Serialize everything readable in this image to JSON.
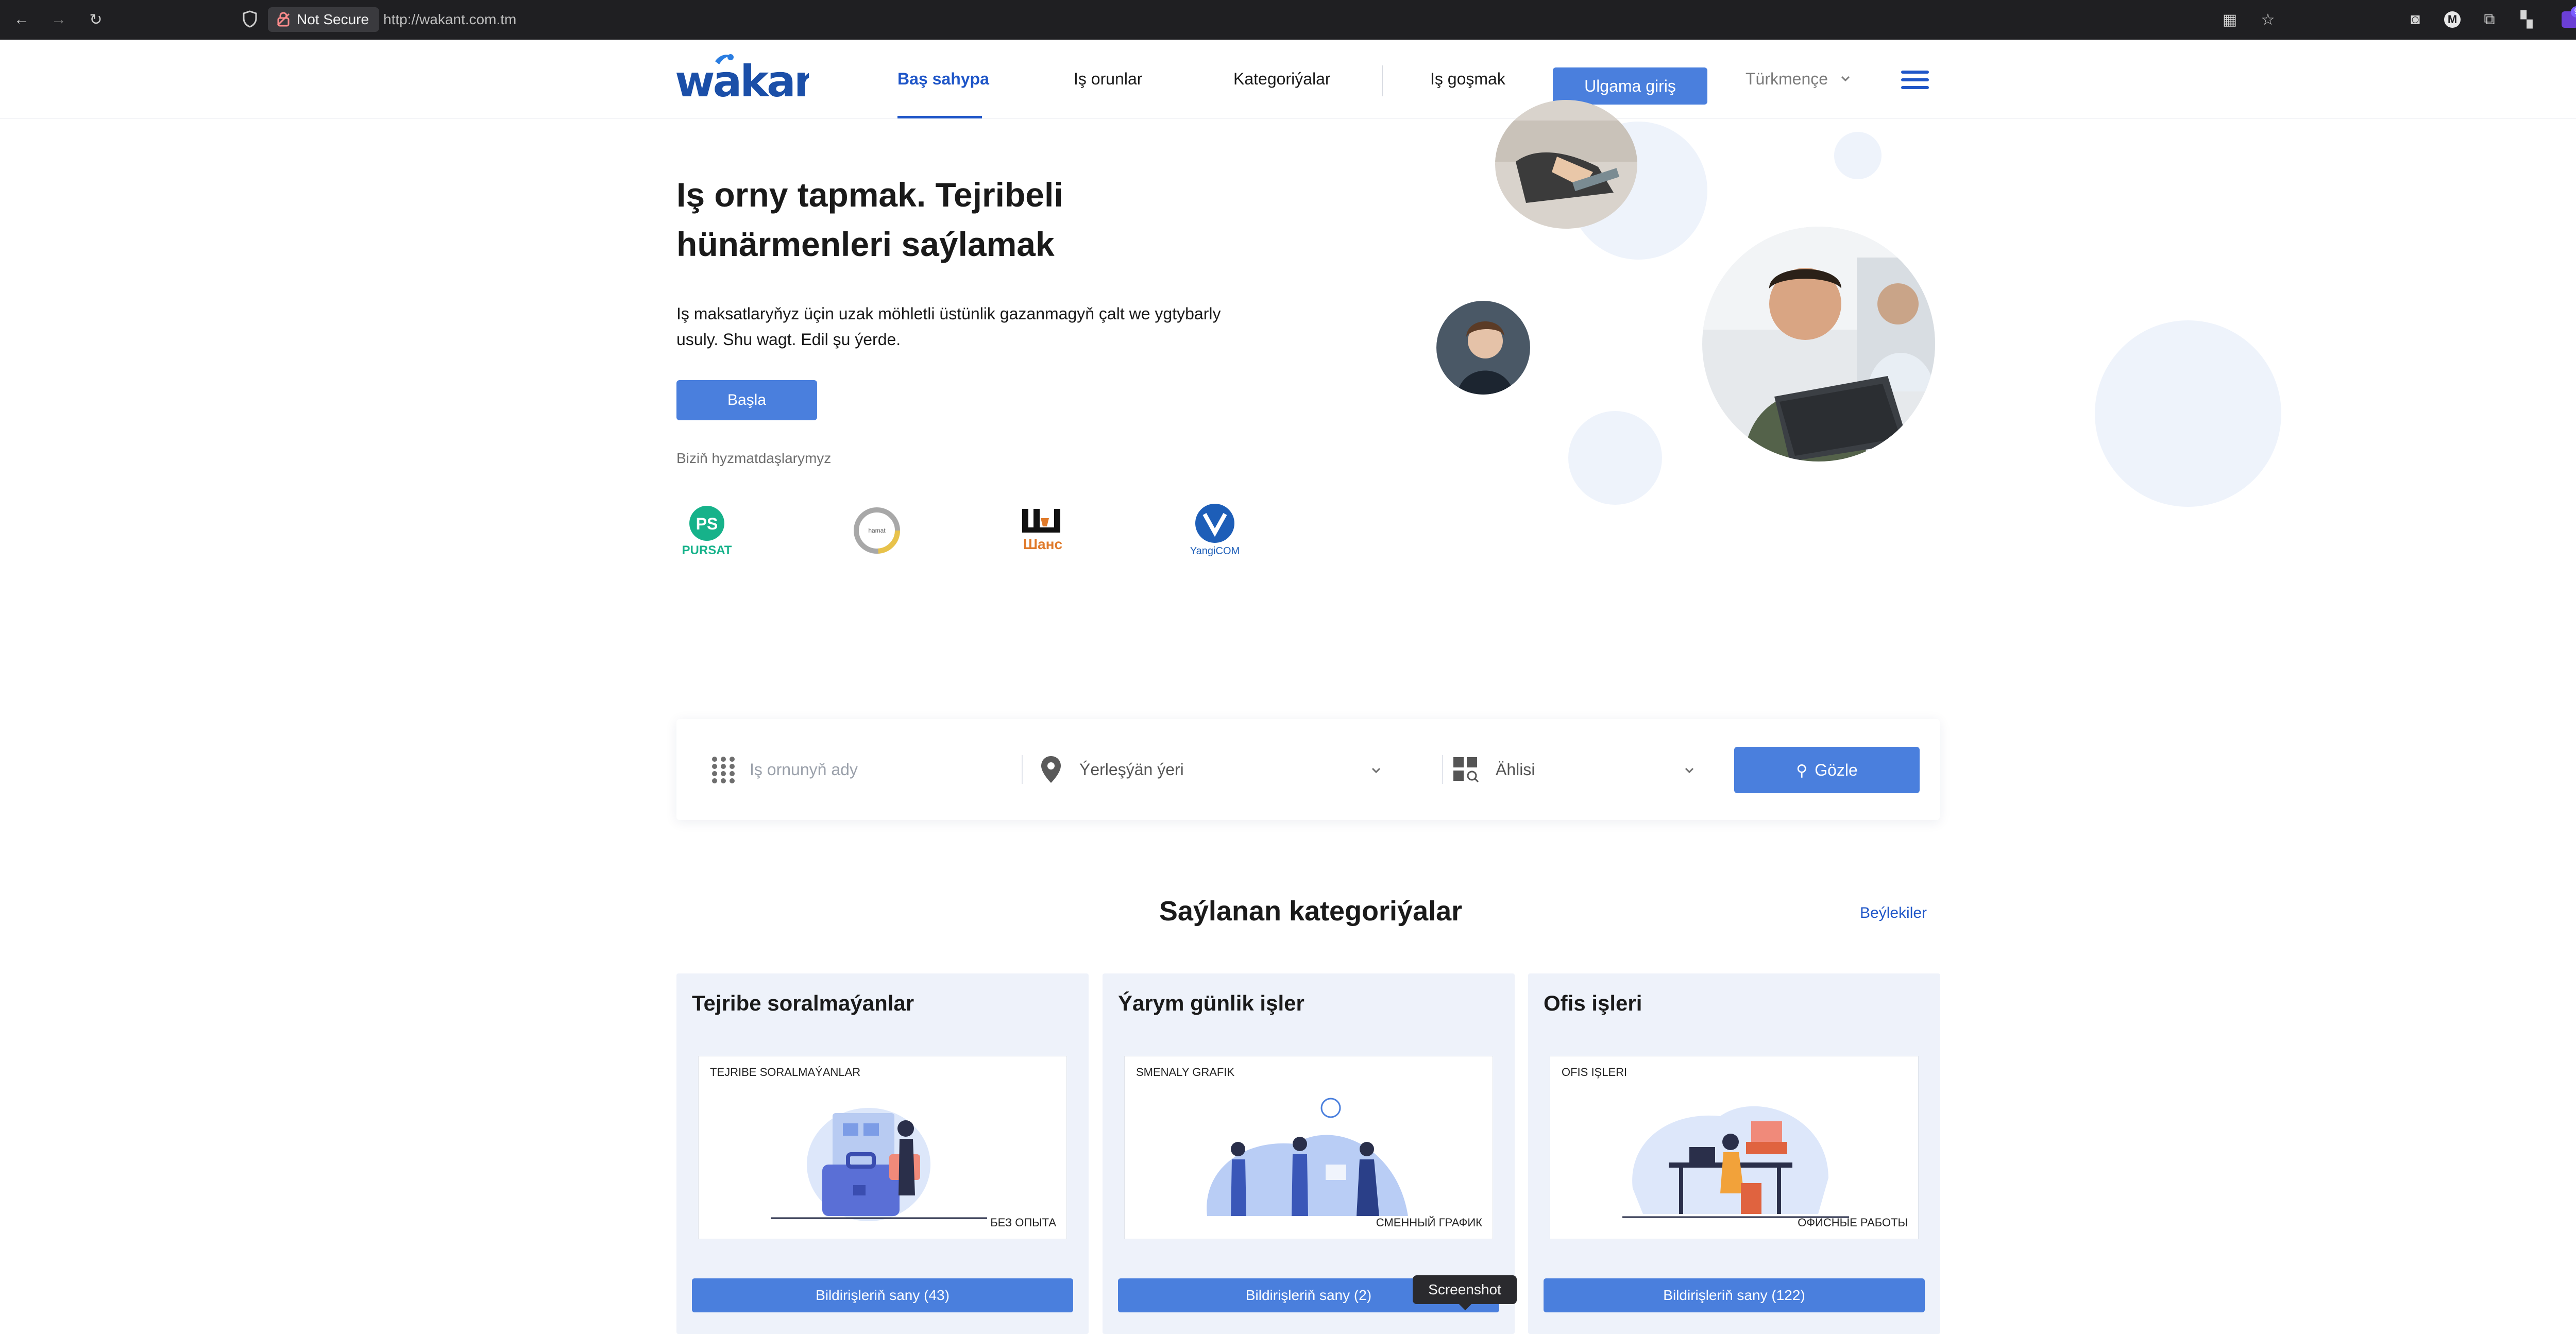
{
  "browser": {
    "security_label": "Not Secure",
    "url": "http://wakant.com.tm",
    "extension_badge": "9"
  },
  "header": {
    "logo_text": "wakant",
    "nav": [
      "Baş sahypa",
      "Iş orunlar",
      "Kategoriýalar",
      "Iş goşmak"
    ],
    "login_button": "Ulgama giriş",
    "language": "Türkmençe"
  },
  "hero": {
    "title_line1": "Iş orny tapmak. Tejribeli",
    "title_line2": "hünärmenleri saýlamak",
    "subtitle_line1": "Iş maksatlaryňyz üçin uzak möhletli üstünlik gazanmagyň çalt we ygtybarly",
    "subtitle_line2": "usuly. Shu wagt. Edil şu ýerde.",
    "start_button": "Başla",
    "partners_title": "Biziň hyzmatdaşlarymyz",
    "partners": [
      "PURSAT",
      "hamat",
      "Шанс",
      "YangiCOM"
    ]
  },
  "search": {
    "job_placeholder": "Iş ornunyň ady",
    "location_placeholder": "Ýerleşýän ýeri",
    "category_placeholder": "Ählisi",
    "search_button": "Gözle"
  },
  "categories": {
    "title": "Saýlanan kategoriýalar",
    "see_all": "Beýlekiler",
    "items": [
      {
        "title": "Tejribe soralmaýanlar",
        "img_top": "TEJRIBE SORALMAÝANLAR",
        "img_bottom": "БЕЗ ОПЫТА",
        "button": "Bildirişleriň sany (43)"
      },
      {
        "title": "Ýarym günlik işler",
        "img_top": "SMENALY GRAFIK",
        "img_bottom": "СМЕННЫЙ ГРАФИК",
        "button": "Bildirişleriň sany (2)"
      },
      {
        "title": "Ofis işleri",
        "img_top": "OFIS IŞLERI",
        "img_bottom": "ОФИСНЫЕ РАБОТЫ",
        "button": "Bildirişleriň sany (122)"
      }
    ]
  },
  "tooltip": "Screenshot",
  "colors": {
    "accent": "#4a7fdd",
    "brand": "#1f56c8",
    "bubble": "#eef3fb",
    "card_bg": "#eef2fa"
  }
}
